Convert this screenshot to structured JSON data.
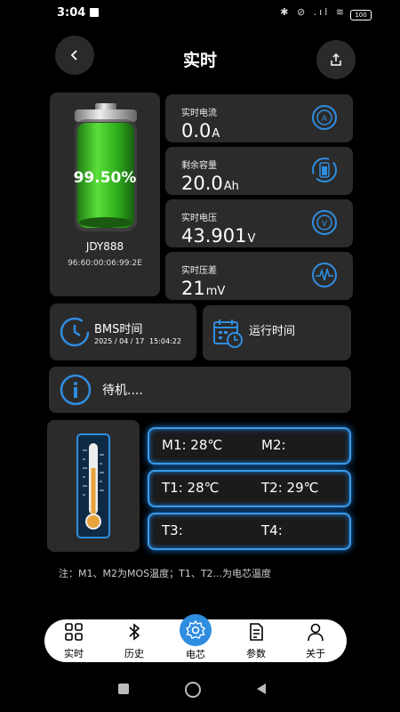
{
  "status_bar": {
    "time": "3:04",
    "icons": "✱ ⊘ .ıl ≋",
    "battery": "100"
  },
  "header": {
    "title": "实时"
  },
  "battery": {
    "percent": "99.50%",
    "name": "JDY888",
    "mac": "96:60:00:06:99:2E"
  },
  "metrics": [
    {
      "label": "实时电流",
      "value": "0.0",
      "unit": "A"
    },
    {
      "label": "剩余容量",
      "value": "20.0",
      "unit": "Ah"
    },
    {
      "label": "实时电压",
      "value": "43.901",
      "unit": "V"
    },
    {
      "label": "实时压差",
      "value": "21",
      "unit": "mV"
    }
  ],
  "bms": {
    "label": "BMS时间",
    "date": "2025 / 04 / 17",
    "time": "15:04:22"
  },
  "runtime": {
    "label": "运行时间"
  },
  "state": {
    "text": "待机...."
  },
  "temps": {
    "m1": "M1: 28℃",
    "m2": "M2:",
    "t1": "T1: 28℃",
    "t2": "T2: 29℃",
    "t3": "T3:",
    "t4": "T4:"
  },
  "note": "注：M1、M2为MOS温度；T1、T2...为电芯温度",
  "nav": [
    {
      "label": "实时",
      "icon": "grid-icon"
    },
    {
      "label": "历史",
      "icon": "bluetooth-icon"
    },
    {
      "label": "电芯",
      "icon": "gear-icon"
    },
    {
      "label": "参数",
      "icon": "document-icon"
    },
    {
      "label": "关于",
      "icon": "person-icon"
    }
  ],
  "colors": {
    "accent": "#2f8de0",
    "card": "#2b2b2b",
    "background": "#000000",
    "battery_green": "#3ec21e"
  }
}
